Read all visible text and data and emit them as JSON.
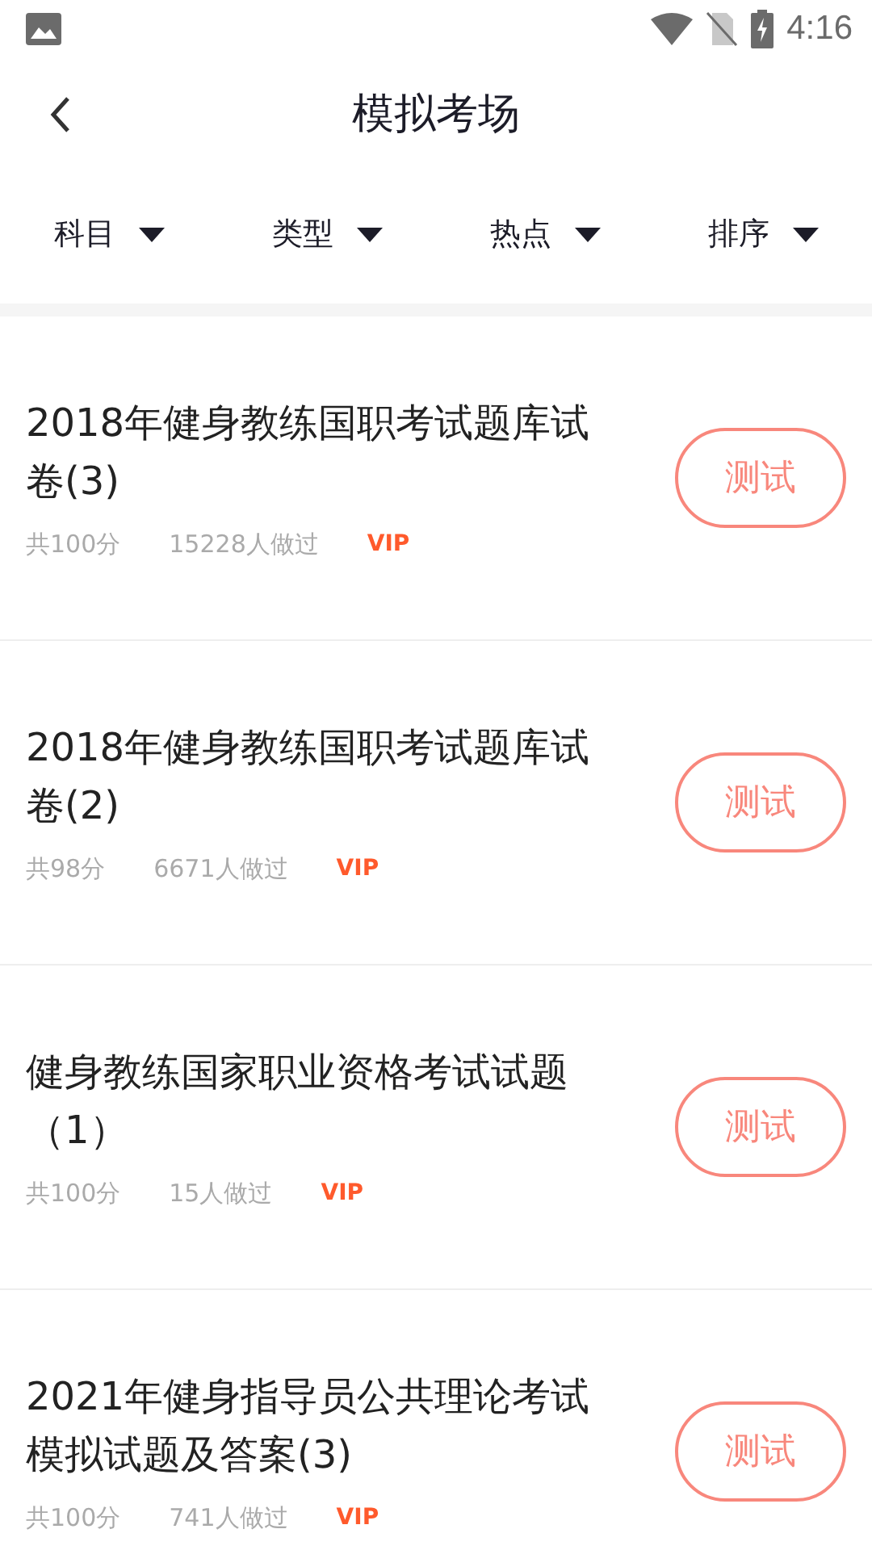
{
  "status_bar": {
    "time": "4:16"
  },
  "header": {
    "title": "模拟考场"
  },
  "filters": [
    {
      "label": "科目"
    },
    {
      "label": "类型"
    },
    {
      "label": "热点"
    },
    {
      "label": "排序"
    }
  ],
  "exams": [
    {
      "title": "2018年健身教练国职考试题库试卷(3)",
      "score": "共100分",
      "takers": "15228人做过",
      "badge": "VIP",
      "button": "测试"
    },
    {
      "title": "2018年健身教练国职考试题库试卷(2)",
      "score": "共98分",
      "takers": "6671人做过",
      "badge": "VIP",
      "button": "测试"
    },
    {
      "title": "健身教练国家职业资格考试试题（1）",
      "score": "共100分",
      "takers": "15人做过",
      "badge": "VIP",
      "button": "测试"
    },
    {
      "title": "2021年健身指导员公共理论考试模拟试题及答案(3)",
      "score": "共100分",
      "takers": "741人做过",
      "badge": "VIP",
      "button": "测试"
    }
  ]
}
